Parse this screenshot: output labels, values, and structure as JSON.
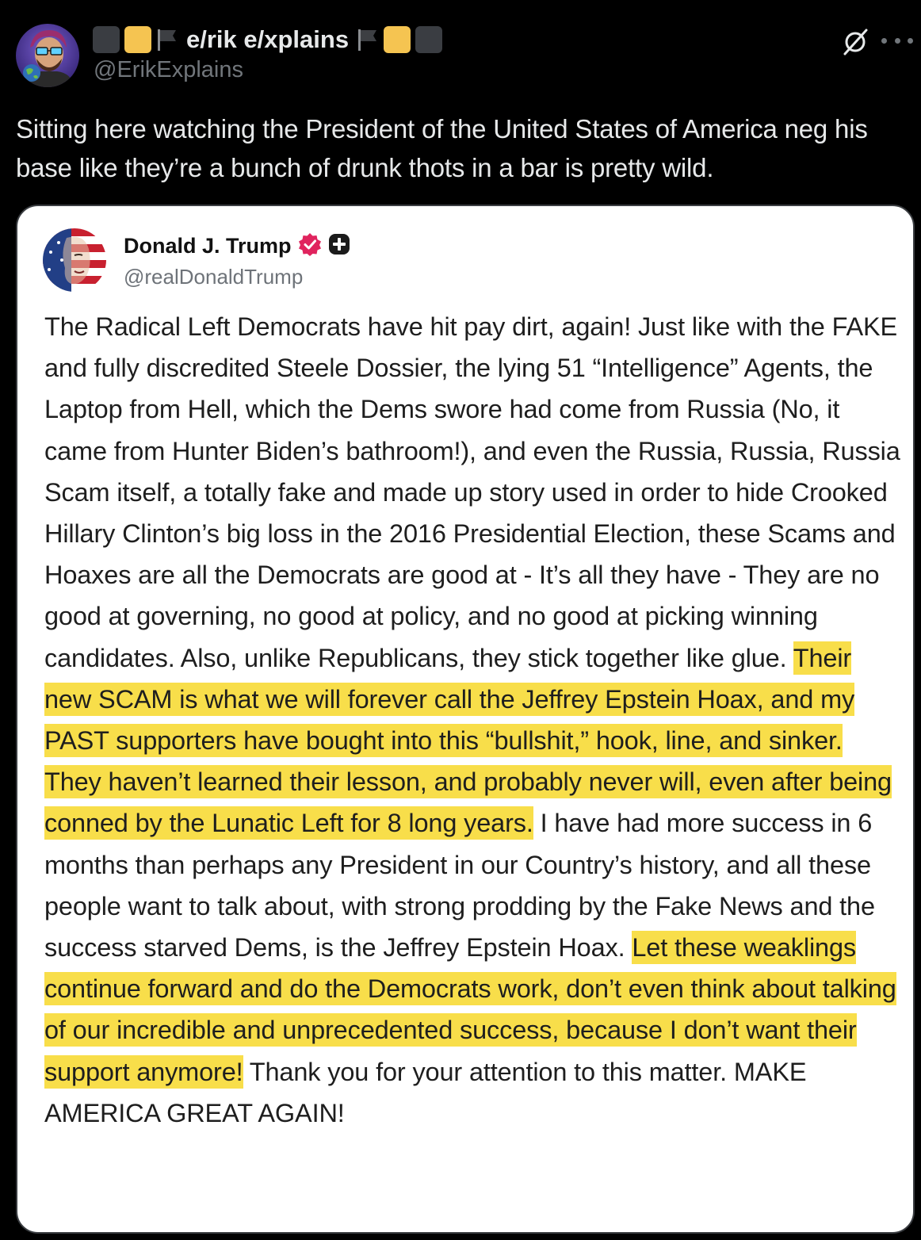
{
  "tweet": {
    "display_name": "e/rik e/xplains",
    "handle": "@ErikExplains",
    "text": "Sitting here watching the President of the United States of America neg his base like they’re a bunch of drunk thots in a bar is pretty wild.",
    "icons": [
      "avatar",
      "grok-icon",
      "more-icon",
      "flag-icon",
      "square-emoji-icon"
    ]
  },
  "embedded_post": {
    "display_name": "Donald J. Trump",
    "handle": "@realDonaldTrump",
    "badges": [
      "verified-badge-icon",
      "plus-badge-icon"
    ],
    "segments": [
      {
        "text": "The Radical Left Democrats have hit pay dirt, again! Just like with the FAKE and fully discredited Steele Dossier, the lying 51 “Intelligence” Agents, the Laptop from Hell, which the Dems swore had come from Russia (No, it came from Hunter Biden’s bathroom!), and even the Russia, Russia, Russia Scam itself, a totally fake and made up story used in order to hide Crooked Hillary Clinton’s big loss in the 2016 Presidential Election, these Scams and Hoaxes are all the Democrats are good at - It’s all they have - They are no good at governing, no good at policy, and no good at picking winning candidates. Also, unlike Republicans, they stick together like glue. ",
        "highlighted": false
      },
      {
        "text": "Their new SCAM is what we will forever call the Jeffrey Epstein Hoax, and my PAST supporters have bought into this “bullshit,” hook, line, and sinker. They haven’t learned their lesson, and probably never will, even after being conned by the Lunatic Left for 8 long years.",
        "highlighted": true
      },
      {
        "text": " I have had more success in 6 months than perhaps any President in our Country’s history, and all these people want to talk about, with strong prodding by the Fake News and the success starved Dems, is the Jeffrey Epstein Hoax. ",
        "highlighted": false
      },
      {
        "text": "Let these weaklings continue forward and do the Democrats work, don’t even think about talking of our incredible and unprecedented success, because I don’t want their support anymore!",
        "highlighted": true
      },
      {
        "text": " Thank you for your attention to this matter. MAKE AMERICA GREAT AGAIN!",
        "highlighted": false
      }
    ]
  },
  "colors": {
    "background": "#000000",
    "text_primary": "#e7e9ea",
    "text_secondary": "#71767b",
    "card_background": "#ffffff",
    "highlight": "#f8de4a",
    "verified_badge": "#e0245e"
  }
}
